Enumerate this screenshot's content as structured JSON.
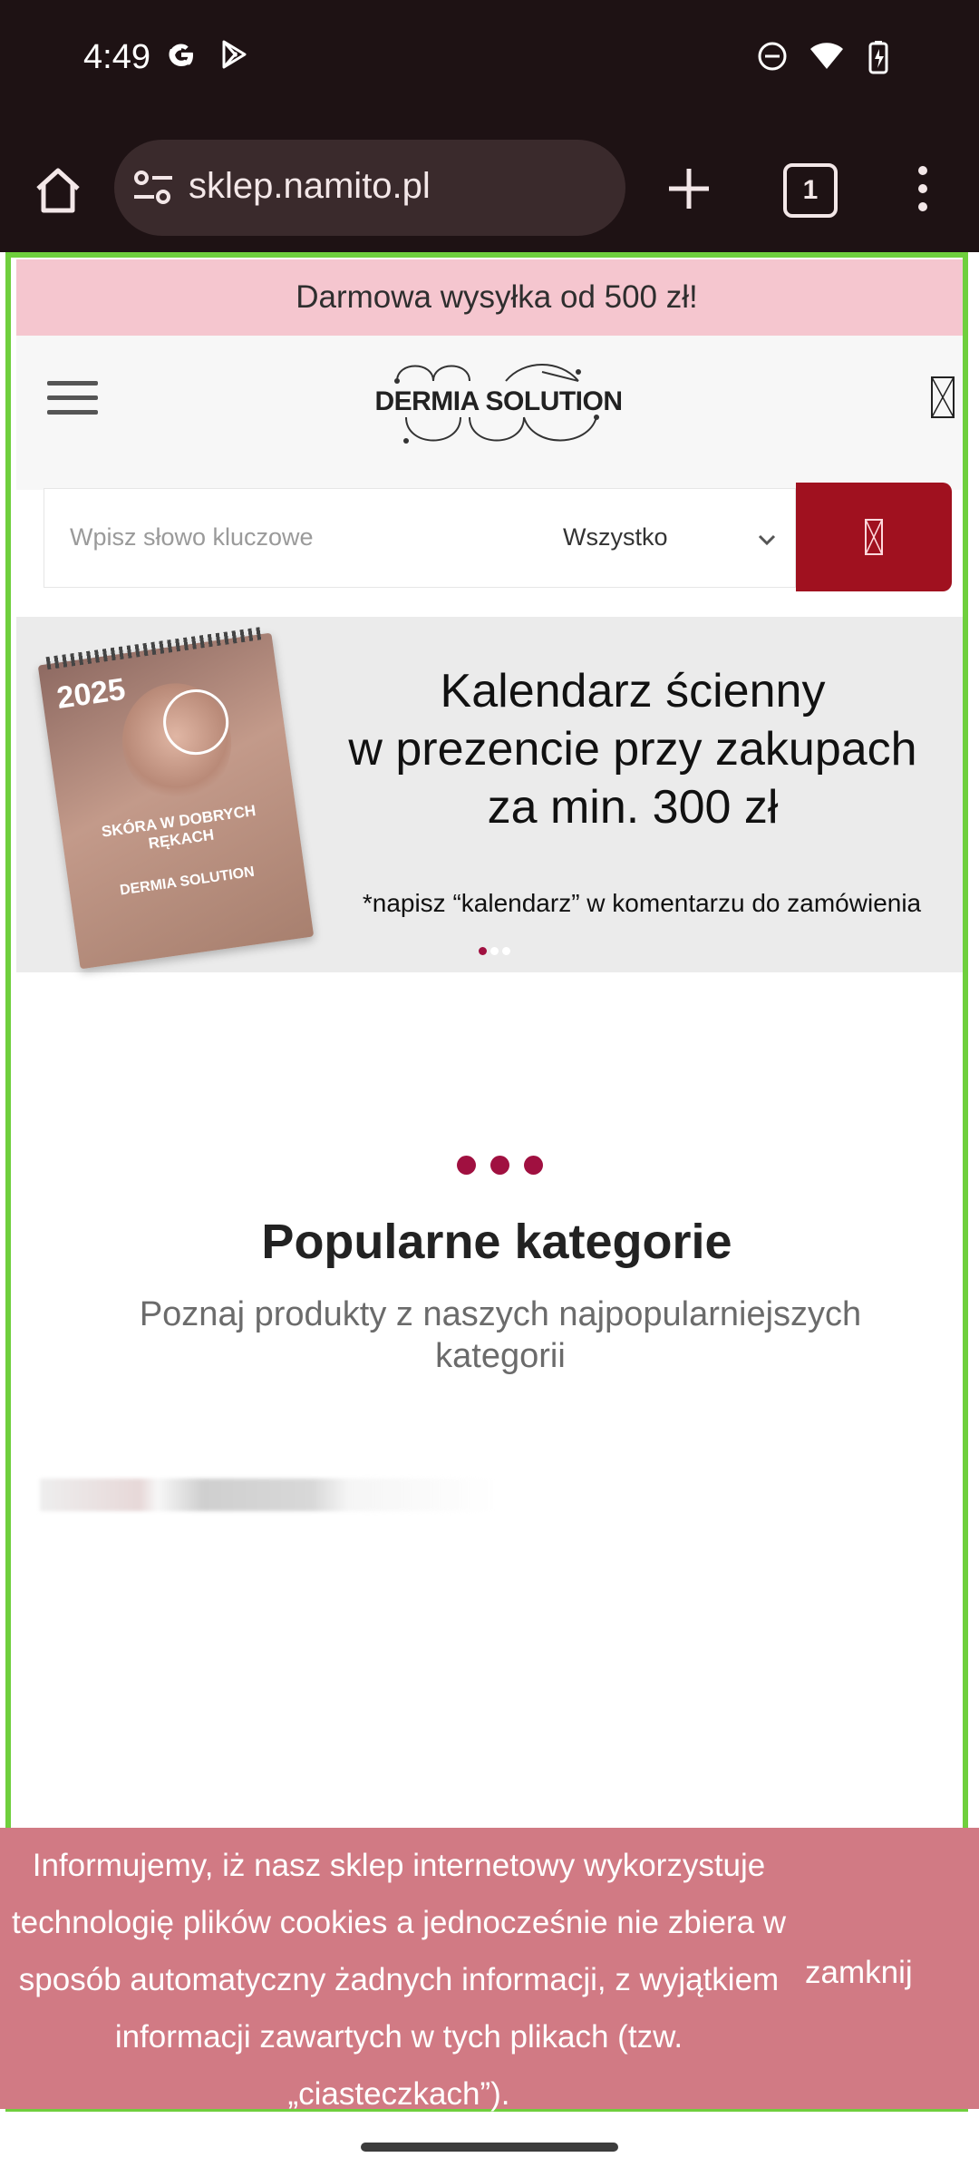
{
  "status_bar": {
    "time": "4:49",
    "left_icons": [
      "google-icon",
      "play-store-icon"
    ],
    "right_icons": [
      "do-not-disturb-icon",
      "wifi-icon",
      "battery-charging-icon"
    ]
  },
  "browser": {
    "url": "sklep.namito.pl",
    "tab_count": "1"
  },
  "page": {
    "promo": "Darmowa wysyłka od 500 zł!",
    "logo_text": "DERMIA SOLUTION",
    "search": {
      "placeholder": "Wpisz słowo kluczowe",
      "category": "Wszystko"
    },
    "banner": {
      "title_lines": [
        "Kalendarz ścienny",
        "w prezencie przy zakupach",
        "za min. 300 zł"
      ],
      "note": "*napisz “kalendarz” w komentarzu do zamówienia",
      "calendar_year": "2025",
      "calendar_tagline": "SKÓRA W DOBRYCH RĘKACH",
      "calendar_logo": "DERMIA SOLUTION",
      "slides": 3,
      "active_slide": 1
    },
    "popular": {
      "title": "Popularne kategorie",
      "subtitle": "Poznaj produkty z naszych najpopularniejszych kategorii"
    },
    "cookie": {
      "text": "Informujemy, iż nasz sklep internetowy wykorzystuje technologię plików cookies a jednocześnie nie zbiera w sposób automatyczny żadnych informacji, z wyjątkiem informacji zawartych w tych plikach (tzw. „ciasteczkach”).",
      "close": "zamknij"
    }
  },
  "colors": {
    "accent": "#a0111f",
    "promo_bg": "#f5c6cf",
    "cookie_bg": "#d17a84",
    "dot": "#a01040",
    "viewport_outline": "#6fcf3d"
  }
}
